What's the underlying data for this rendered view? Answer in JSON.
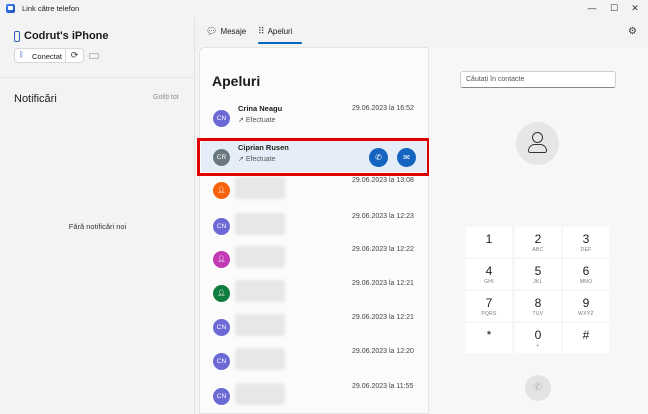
{
  "window": {
    "title": "Link către telefon",
    "minimize": "—",
    "maximize": "☐",
    "close": "✕"
  },
  "device": {
    "name": "Codrut's iPhone",
    "connection_label": "Conectat",
    "bluetooth_icon": "bluetooth-icon",
    "refresh_icon": "refresh-icon",
    "battery_icon": "battery-icon"
  },
  "notifications": {
    "title": "Notificări",
    "clear_all": "Goliți tot",
    "empty_text": "Fără notificări noi"
  },
  "tabs": [
    {
      "label": "Mesaje",
      "icon": "message-icon",
      "active": false
    },
    {
      "label": "Apeluri",
      "icon": "dialpad-icon",
      "active": true
    }
  ],
  "settings_icon": "gear-icon",
  "calls": {
    "title": "Apeluri",
    "items": [
      {
        "initials": "CN",
        "name": "Crina Neagu",
        "type": "Efectuate",
        "date": "29.06.2023 la 16:52",
        "avatar_color": "#6b69d6"
      },
      {
        "initials": "CR",
        "name": "Ciprian Rusen",
        "type": "Efectuate",
        "date": "",
        "avatar_color": "#69797e",
        "selected": true
      },
      {
        "initials": "",
        "name": "",
        "type": "",
        "date": "29.06.2023 la 13:08",
        "avatar_color": "#f7630c"
      },
      {
        "initials": "CN",
        "name": "",
        "type": "",
        "date": "29.06.2023 la 12:23",
        "avatar_color": "#6b69d6"
      },
      {
        "initials": "",
        "name": "",
        "type": "",
        "date": "29.06.2023 la 12:22",
        "avatar_color": "#c239b3"
      },
      {
        "initials": "",
        "name": "",
        "type": "",
        "date": "29.06.2023 la 12:21",
        "avatar_color": "#107c41"
      },
      {
        "initials": "CN",
        "name": "",
        "type": "",
        "date": "29.06.2023 la 12:21",
        "avatar_color": "#6b69d6"
      },
      {
        "initials": "CN",
        "name": "",
        "type": "",
        "date": "29.06.2023 la 12:20",
        "avatar_color": "#6b69d6"
      },
      {
        "initials": "CN",
        "name": "",
        "type": "",
        "date": "29.06.2023 la 11:55",
        "avatar_color": "#6b69d6"
      }
    ]
  },
  "dialer": {
    "search_placeholder": "Căutați în contacte",
    "keys": [
      {
        "digit": "1",
        "letters": ""
      },
      {
        "digit": "2",
        "letters": "ABC"
      },
      {
        "digit": "3",
        "letters": "DEF"
      },
      {
        "digit": "4",
        "letters": "GHI"
      },
      {
        "digit": "5",
        "letters": "JKL"
      },
      {
        "digit": "6",
        "letters": "MNO"
      },
      {
        "digit": "7",
        "letters": "PQRS"
      },
      {
        "digit": "8",
        "letters": "TUV"
      },
      {
        "digit": "9",
        "letters": "WXYZ"
      },
      {
        "digit": "*",
        "letters": ""
      },
      {
        "digit": "0",
        "letters": "+"
      },
      {
        "digit": "#",
        "letters": ""
      }
    ]
  },
  "colors": {
    "accent": "#0067c0",
    "highlight": "#e00000",
    "call_button": "#1565c0"
  }
}
